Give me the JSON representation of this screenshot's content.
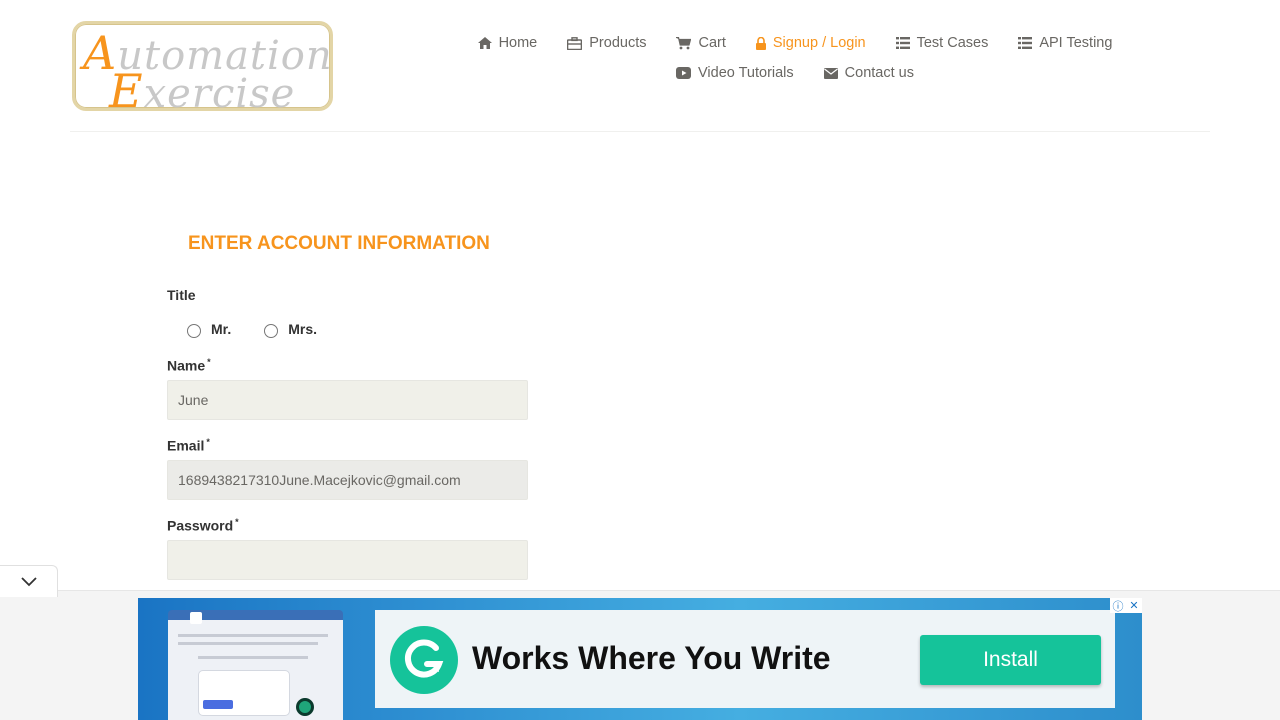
{
  "header": {
    "logo": {
      "line1": "Automation",
      "line2": "Exercise"
    },
    "nav_row1": [
      {
        "label": "Home",
        "icon": "home-icon",
        "active": false
      },
      {
        "label": "Products",
        "icon": "briefcase-icon",
        "active": false
      },
      {
        "label": "Cart",
        "icon": "cart-icon",
        "active": false
      },
      {
        "label": "Signup / Login",
        "icon": "lock-icon",
        "active": true
      },
      {
        "label": "Test Cases",
        "icon": "list-icon",
        "active": false
      },
      {
        "label": "API Testing",
        "icon": "list-icon",
        "active": false
      }
    ],
    "nav_row2": [
      {
        "label": "Video Tutorials",
        "icon": "youtube-play-icon",
        "active": false
      },
      {
        "label": "Contact us",
        "icon": "envelope-icon",
        "active": false
      }
    ]
  },
  "form": {
    "title": "ENTER ACCOUNT INFORMATION",
    "title_label": "Title",
    "title_options": [
      "Mr.",
      "Mrs."
    ],
    "name_label": "Name",
    "name_value": "June",
    "email_label": "Email",
    "email_value": "1689438217310June.Macejkovic@gmail.com",
    "password_label": "Password",
    "password_value": "",
    "required_mark": "*"
  },
  "ad": {
    "headline": "Works Where You Write",
    "cta": "Install",
    "info_symbol": "ⓘ",
    "close_symbol": "✕"
  },
  "colors": {
    "accent": "#f7941d",
    "text": "#696763",
    "input_bg": "#f0f0e9",
    "ad_brand": "#15c39a"
  }
}
